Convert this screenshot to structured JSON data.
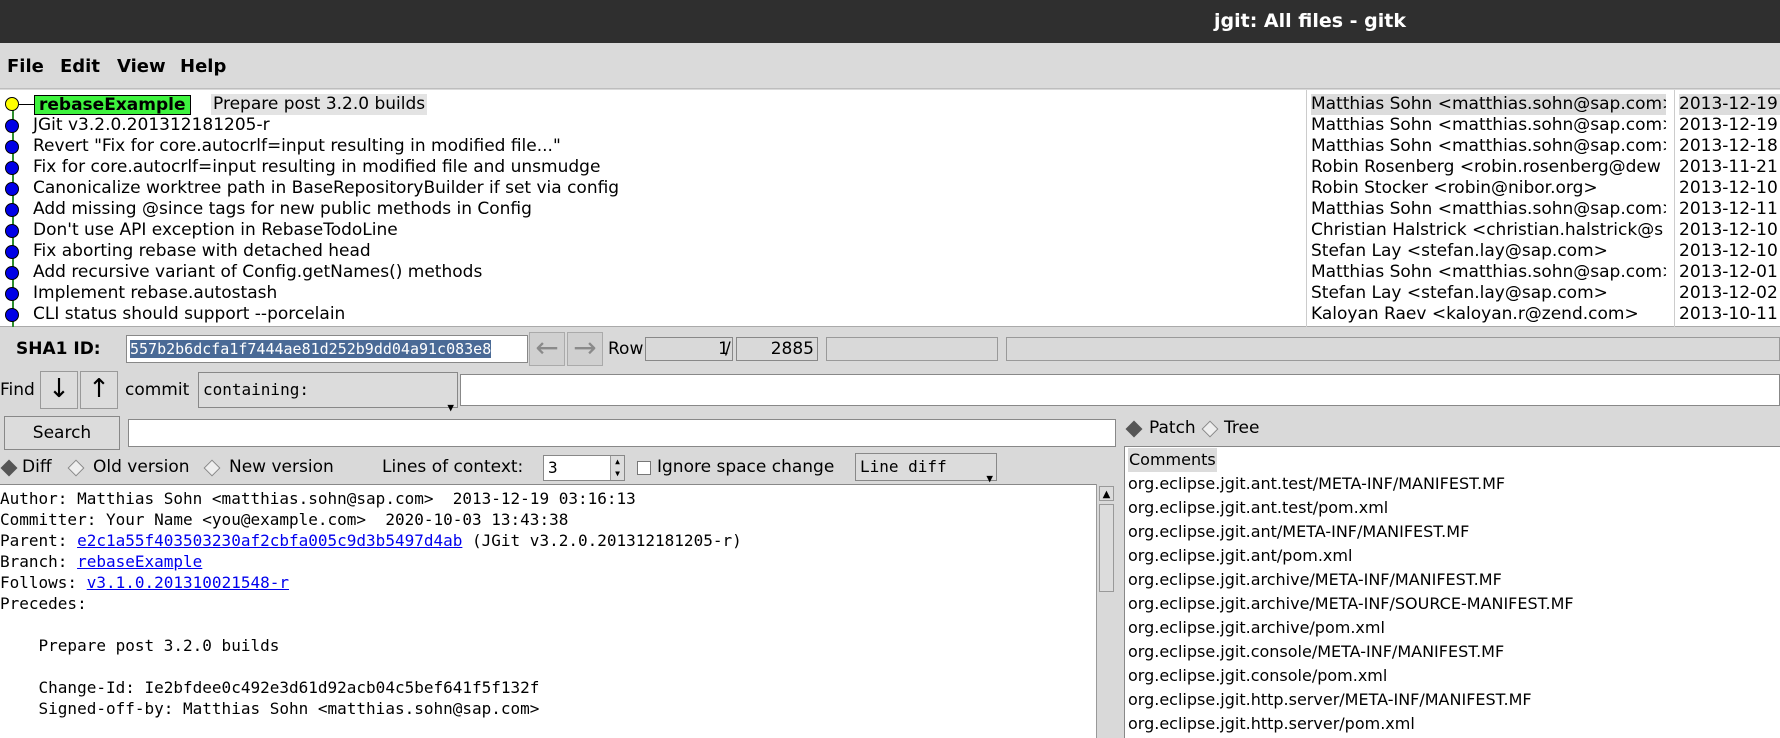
{
  "window": {
    "title": "jgit: All files - gitk"
  },
  "menu": [
    {
      "label": "File"
    },
    {
      "label": "Edit"
    },
    {
      "label": "View"
    },
    {
      "label": "Help"
    }
  ],
  "branch_tag": "rebaseExample",
  "commits": [
    {
      "message": "Prepare post 3.2.0 builds",
      "author": "Matthias Sohn <matthias.sohn@sap.com>",
      "date": "2013-12-19"
    },
    {
      "message": "JGit v3.2.0.201312181205-r",
      "author": "Matthias Sohn <matthias.sohn@sap.com>",
      "date": "2013-12-19"
    },
    {
      "message": "Revert \"Fix for core.autocrlf=input resulting in modified file...\"",
      "author": "Matthias Sohn <matthias.sohn@sap.com>",
      "date": "2013-12-18"
    },
    {
      "message": "Fix for core.autocrlf=input resulting in modified file and unsmudge",
      "author": "Robin Rosenberg <robin.rosenberg@dew",
      "date": "2013-11-21"
    },
    {
      "message": "Canonicalize worktree path in BaseRepositoryBuilder if set via config",
      "author": "Robin Stocker <robin@nibor.org>",
      "date": "2013-12-10"
    },
    {
      "message": "Add missing @since tags for new public methods in Config",
      "author": "Matthias Sohn <matthias.sohn@sap.com>",
      "date": "2013-12-11"
    },
    {
      "message": "Don't use API exception in RebaseTodoLine",
      "author": "Christian Halstrick <christian.halstrick@s",
      "date": "2013-12-10"
    },
    {
      "message": "Fix aborting rebase with detached head",
      "author": "Stefan Lay <stefan.lay@sap.com>",
      "date": "2013-12-10"
    },
    {
      "message": "Add recursive variant of Config.getNames() methods",
      "author": "Matthias Sohn <matthias.sohn@sap.com>",
      "date": "2013-12-01"
    },
    {
      "message": "Implement rebase.autostash",
      "author": "Stefan Lay <stefan.lay@sap.com>",
      "date": "2013-12-02"
    },
    {
      "message": "CLI status should support --porcelain",
      "author": "Kaloyan Raev <kaloyan.r@zend.com>",
      "date": "2013-10-11"
    }
  ],
  "sha": {
    "label": "SHA1 ID:",
    "value": "557b2b6dcfa1f7444ae81d252b9dd04a91c083e8",
    "row_label": "Row",
    "row_current": "1",
    "row_sep": "/",
    "row_total": "2885"
  },
  "find": {
    "label": "Find",
    "type_label": "commit",
    "mode": "containing:",
    "value": ""
  },
  "search": {
    "button": "Search",
    "value": ""
  },
  "diff_options": {
    "diff": "Diff",
    "old_version": "Old version",
    "new_version": "New version",
    "context_label": "Lines of context:",
    "context_value": "3",
    "ignore_space": "Ignore space change",
    "line_diff": "Line diff"
  },
  "details": {
    "author": "Author: Matthias Sohn <matthias.sohn@sap.com>  2013-12-19 03:16:13",
    "committer": "Committer: Your Name <you@example.com>  2020-10-03 13:43:38",
    "parent_label": "Parent: ",
    "parent_hash": "e2c1a55f403503230af2cbfa005c9d3b5497d4ab",
    "parent_desc": " (JGit v3.2.0.201312181205-r)",
    "branch_label": "Branch: ",
    "branch": "rebaseExample",
    "follows_label": "Follows: ",
    "follows": "v3.1.0.201310021548-r",
    "precedes": "Precedes:",
    "msg_title": "    Prepare post 3.2.0 builds",
    "change_id": "    Change-Id: Ie2bfdee0c492e3d61d92acb04c5bef641f5f132f",
    "signed_off": "    Signed-off-by: Matthias Sohn <matthias.sohn@sap.com>"
  },
  "right_panel": {
    "patch": "Patch",
    "tree": "Tree",
    "files": [
      "Comments",
      "org.eclipse.jgit.ant.test/META-INF/MANIFEST.MF",
      "org.eclipse.jgit.ant.test/pom.xml",
      "org.eclipse.jgit.ant/META-INF/MANIFEST.MF",
      "org.eclipse.jgit.ant/pom.xml",
      "org.eclipse.jgit.archive/META-INF/MANIFEST.MF",
      "org.eclipse.jgit.archive/META-INF/SOURCE-MANIFEST.MF",
      "org.eclipse.jgit.archive/pom.xml",
      "org.eclipse.jgit.console/META-INF/MANIFEST.MF",
      "org.eclipse.jgit.console/pom.xml",
      "org.eclipse.jgit.http.server/META-INF/MANIFEST.MF",
      "org.eclipse.jgit.http.server/pom.xml"
    ]
  }
}
